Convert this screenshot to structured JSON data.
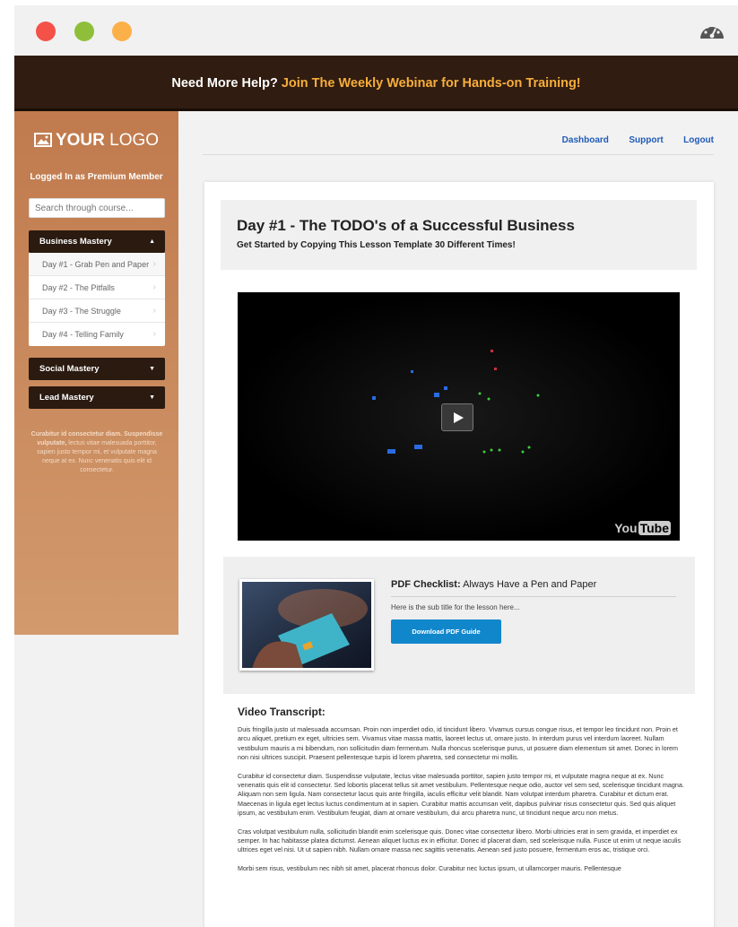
{
  "banner": {
    "lead": "Need More Help?",
    "highlight": "Join The Weekly Webinar for Hands-on Training!"
  },
  "sidebar": {
    "logo_bold": "YOUR",
    "logo_light": "LOGO",
    "member_status": "Logged In as Premium Member",
    "search_placeholder": "Search through course...",
    "sections": [
      {
        "label": "Business Mastery",
        "expanded": true,
        "items": [
          {
            "label": "Day #1 - Grab Pen and Paper"
          },
          {
            "label": "Day #2 - The Pitfalls"
          },
          {
            "label": "Day #3 - The Struggle"
          },
          {
            "label": "Day #4 - Telling Family"
          }
        ]
      },
      {
        "label": "Social Mastery",
        "expanded": false
      },
      {
        "label": "Lead Mastery",
        "expanded": false
      }
    ],
    "blurb_lead": "Curabitur id consectetur diam. Suspendisse vulputate,",
    "blurb_rest": "lectus vitae malesuada porttitor, sapien justo tempor mi, et vulputate magna neque at ex. Nunc venenatis quis elit id consectetur."
  },
  "nav": {
    "dashboard": "Dashboard",
    "support": "Support",
    "logout": "Logout"
  },
  "lesson": {
    "title": "Day #1 - The TODO's of a Successful Business",
    "subtitle": "Get Started by Copying This Lesson Template 30 Different Times!"
  },
  "video": {
    "brand_a": "You",
    "brand_b": "Tube"
  },
  "pdf": {
    "label": "PDF Checklist:",
    "title": "Always Have a Pen and Paper",
    "subtitle": "Here is the sub title for the lesson here...",
    "button": "Download PDF Guide"
  },
  "transcript": {
    "heading": "Video Transcript:",
    "paragraphs": [
      "Duis fringilla justo ut malesuada accumsan. Proin non imperdiet odio, id tincidunt libero. Vivamus cursus congue risus, et tempor leo tincidunt non. Proin et arcu aliquet, pretium ex eget, ultricies sem. Vivamus vitae massa mattis, laoreet lectus ut, ornare justo. In interdum purus vel interdum laoreet. Nullam vestibulum mauris a mi bibendum, non sollicitudin diam fermentum. Nulla rhoncus scelerisque purus, ut posuere diam elementum sit amet. Donec in lorem non nisi ultrices suscipit. Praesent pellentesque turpis id lorem pharetra, sed consectetur mi mollis.",
      "Curabitur id consectetur diam. Suspendisse vulputate, lectus vitae malesuada porttitor, sapien justo tempor mi, et vulputate magna neque at ex. Nunc venenatis quis elit id consectetur. Sed lobortis placerat tellus sit amet vestibulum. Pellentesque neque odio, auctor vel sem sed, scelerisque tincidunt magna. Aliquam non sem ligula. Nam consectetur lacus quis ante fringilla, iaculis efficitur velit blandit. Nam volutpat interdum pharetra. Curabitur et dictum erat. Maecenas in ligula eget lectus luctus condimentum at in sapien. Curabitur mattis accumsan velit, dapibus pulvinar risus consectetur quis. Sed quis aliquet ipsum, ac vestibulum enim. Vestibulum feugiat, diam at ornare vestibulum, dui arcu pharetra nunc, ut tincidunt neque arcu non metus.",
      "Cras volutpat vestibulum nulla, sollicitudin blandit enim scelerisque quis. Donec vitae consectetur libero. Morbi ultricies erat in sem gravida, et imperdiet ex semper. In hac habitasse platea dictumst. Aenean aliquet luctus ex in efficitur. Donec id placerat diam, sed scelerisque nulla. Fusce ut enim ut neque iaculis ultrices eget vel nisi. Ut ut sapien nibh. Nullam ornare massa nec sagittis venenatis. Aenean sed justo posuere, fermentum eros ac, tristique orci.",
      "Morbi sem risus, vestibulum nec nibh sit amet, placerat rhoncus dolor. Curabitur nec luctus ipsum, ut ullamcorper mauris. Pellentesque"
    ]
  },
  "colors": {
    "banner_bg": "#301c10",
    "banner_highlight": "#f7ae3b",
    "sidebar": "#c07a4d",
    "accent_blue": "#1187cb",
    "nav_link": "#1f5ab8"
  }
}
